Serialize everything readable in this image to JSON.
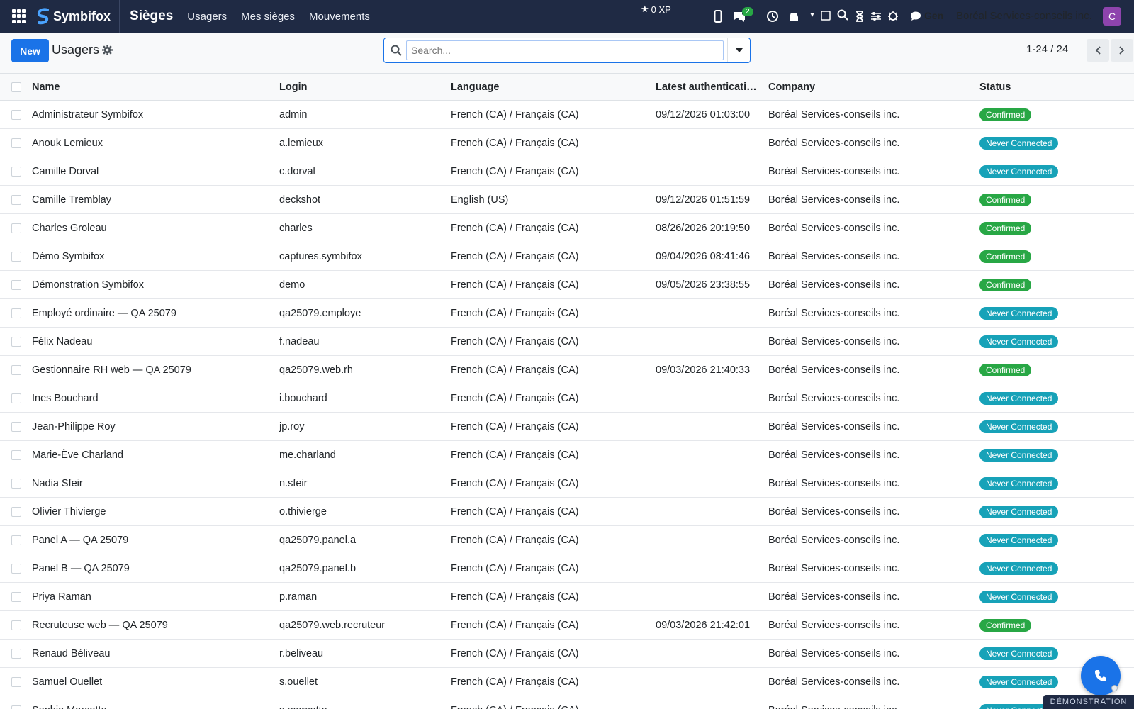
{
  "navbar": {
    "brand": "Symbifox",
    "app_title": "Sièges",
    "links": [
      "Usagers",
      "Mes sièges",
      "Mouvements"
    ],
    "xp": "0 XP",
    "chat_badge": "2",
    "gen_label": "Gen",
    "company": "Boréal Services-conseils inc.",
    "avatar_initial": "C",
    "avatar_color": "#8e44ad"
  },
  "control": {
    "new_label": "New",
    "breadcrumb": "Usagers",
    "search_placeholder": "Search...",
    "pager": "1-24 / 24",
    "accent": "#1a73e8"
  },
  "table": {
    "columns": {
      "name": "Name",
      "login": "Login",
      "language": "Language",
      "auth": "Latest authenticati…",
      "company": "Company",
      "status": "Status"
    },
    "rows": [
      {
        "name": "Administrateur Symbifox",
        "login": "admin",
        "language": "French (CA) / Français (CA)",
        "auth": "09/12/2026 01:03:00",
        "company": "Boréal Services-conseils inc.",
        "status": "Confirmed",
        "kind": "confirmed"
      },
      {
        "name": "Anouk Lemieux",
        "login": "a.lemieux",
        "language": "French (CA) / Français (CA)",
        "auth": "",
        "company": "Boréal Services-conseils inc.",
        "status": "Never Connected",
        "kind": "never"
      },
      {
        "name": "Camille Dorval",
        "login": "c.dorval",
        "language": "French (CA) / Français (CA)",
        "auth": "",
        "company": "Boréal Services-conseils inc.",
        "status": "Never Connected",
        "kind": "never"
      },
      {
        "name": "Camille Tremblay",
        "login": "deckshot",
        "language": "English (US)",
        "auth": "09/12/2026 01:51:59",
        "company": "Boréal Services-conseils inc.",
        "status": "Confirmed",
        "kind": "confirmed"
      },
      {
        "name": "Charles Groleau",
        "login": "charles",
        "language": "French (CA) / Français (CA)",
        "auth": "08/26/2026 20:19:50",
        "company": "Boréal Services-conseils inc.",
        "status": "Confirmed",
        "kind": "confirmed"
      },
      {
        "name": "Démo Symbifox",
        "login": "captures.symbifox",
        "language": "French (CA) / Français (CA)",
        "auth": "09/04/2026 08:41:46",
        "company": "Boréal Services-conseils inc.",
        "status": "Confirmed",
        "kind": "confirmed"
      },
      {
        "name": "Démonstration Symbifox",
        "login": "demo",
        "language": "French (CA) / Français (CA)",
        "auth": "09/05/2026 23:38:55",
        "company": "Boréal Services-conseils inc.",
        "status": "Confirmed",
        "kind": "confirmed"
      },
      {
        "name": "Employé ordinaire — QA 25079",
        "login": "qa25079.employe",
        "language": "French (CA) / Français (CA)",
        "auth": "",
        "company": "Boréal Services-conseils inc.",
        "status": "Never Connected",
        "kind": "never"
      },
      {
        "name": "Félix Nadeau",
        "login": "f.nadeau",
        "language": "French (CA) / Français (CA)",
        "auth": "",
        "company": "Boréal Services-conseils inc.",
        "status": "Never Connected",
        "kind": "never"
      },
      {
        "name": "Gestionnaire RH web — QA 25079",
        "login": "qa25079.web.rh",
        "language": "French (CA) / Français (CA)",
        "auth": "09/03/2026 21:40:33",
        "company": "Boréal Services-conseils inc.",
        "status": "Confirmed",
        "kind": "confirmed"
      },
      {
        "name": "Ines Bouchard",
        "login": "i.bouchard",
        "language": "French (CA) / Français (CA)",
        "auth": "",
        "company": "Boréal Services-conseils inc.",
        "status": "Never Connected",
        "kind": "never"
      },
      {
        "name": "Jean-Philippe Roy",
        "login": "jp.roy",
        "language": "French (CA) / Français (CA)",
        "auth": "",
        "company": "Boréal Services-conseils inc.",
        "status": "Never Connected",
        "kind": "never"
      },
      {
        "name": "Marie-Ève Charland",
        "login": "me.charland",
        "language": "French (CA) / Français (CA)",
        "auth": "",
        "company": "Boréal Services-conseils inc.",
        "status": "Never Connected",
        "kind": "never"
      },
      {
        "name": "Nadia Sfeir",
        "login": "n.sfeir",
        "language": "French (CA) / Français (CA)",
        "auth": "",
        "company": "Boréal Services-conseils inc.",
        "status": "Never Connected",
        "kind": "never"
      },
      {
        "name": "Olivier Thivierge",
        "login": "o.thivierge",
        "language": "French (CA) / Français (CA)",
        "auth": "",
        "company": "Boréal Services-conseils inc.",
        "status": "Never Connected",
        "kind": "never"
      },
      {
        "name": "Panel A — QA 25079",
        "login": "qa25079.panel.a",
        "language": "French (CA) / Français (CA)",
        "auth": "",
        "company": "Boréal Services-conseils inc.",
        "status": "Never Connected",
        "kind": "never"
      },
      {
        "name": "Panel B — QA 25079",
        "login": "qa25079.panel.b",
        "language": "French (CA) / Français (CA)",
        "auth": "",
        "company": "Boréal Services-conseils inc.",
        "status": "Never Connected",
        "kind": "never"
      },
      {
        "name": "Priya Raman",
        "login": "p.raman",
        "language": "French (CA) / Français (CA)",
        "auth": "",
        "company": "Boréal Services-conseils inc.",
        "status": "Never Connected",
        "kind": "never"
      },
      {
        "name": "Recruteuse web — QA 25079",
        "login": "qa25079.web.recruteur",
        "language": "French (CA) / Français (CA)",
        "auth": "09/03/2026 21:42:01",
        "company": "Boréal Services-conseils inc.",
        "status": "Confirmed",
        "kind": "confirmed"
      },
      {
        "name": "Renaud Béliveau",
        "login": "r.beliveau",
        "language": "French (CA) / Français (CA)",
        "auth": "",
        "company": "Boréal Services-conseils inc.",
        "status": "Never Connected",
        "kind": "never"
      },
      {
        "name": "Samuel Ouellet",
        "login": "s.ouellet",
        "language": "French (CA) / Français (CA)",
        "auth": "",
        "company": "Boréal Services-conseils inc.",
        "status": "Never Connected",
        "kind": "never"
      },
      {
        "name": "Sophie Marcotte",
        "login": "s.marcotte",
        "language": "French (CA) / Français (CA)",
        "auth": "",
        "company": "Boréal Services-conseils inc.",
        "status": "Never Connected",
        "kind": "never"
      }
    ]
  },
  "status_colors": {
    "confirmed": "#28a745",
    "never": "#17a2b8"
  },
  "demo_tag": "DÉMONSTRATION"
}
